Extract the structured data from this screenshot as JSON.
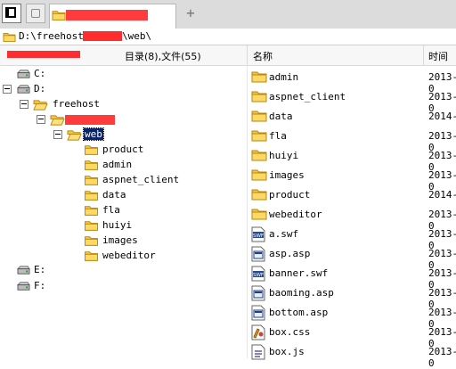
{
  "path": {
    "prefix": "D:\\freehost\\",
    "suffix": "\\web\\"
  },
  "header": {
    "counts": "目录(8),文件(55)",
    "col_name": "名称",
    "col_time": "时间"
  },
  "tree": {
    "drive_c": "C:",
    "drive_d": "D:",
    "freehost": "freehost",
    "web": "web",
    "children": [
      "product",
      "admin",
      "aspnet_client",
      "data",
      "fla",
      "huiyi",
      "images",
      "webeditor"
    ],
    "drive_e": "E:",
    "drive_f": "F:"
  },
  "files": [
    {
      "name": "admin",
      "time": "2013-0",
      "icon": "folder-icon"
    },
    {
      "name": "aspnet_client",
      "time": "2013-0",
      "icon": "folder-icon"
    },
    {
      "name": "data",
      "time": "2014-",
      "icon": "folder-icon"
    },
    {
      "name": "fla",
      "time": "2013-0",
      "icon": "folder-icon"
    },
    {
      "name": "huiyi",
      "time": "2013-0",
      "icon": "folder-icon"
    },
    {
      "name": "images",
      "time": "2013-0",
      "icon": "folder-icon"
    },
    {
      "name": "product",
      "time": "2014-",
      "icon": "folder-icon"
    },
    {
      "name": "webeditor",
      "time": "2013-0",
      "icon": "folder-icon"
    },
    {
      "name": "a.swf",
      "time": "2013-0",
      "icon": "swf-file-icon"
    },
    {
      "name": "asp.asp",
      "time": "2013-0",
      "icon": "asp-file-icon"
    },
    {
      "name": "banner.swf",
      "time": "2013-0",
      "icon": "swf-file-icon"
    },
    {
      "name": "baoming.asp",
      "time": "2013-0",
      "icon": "asp-file-icon"
    },
    {
      "name": "bottom.asp",
      "time": "2013-0",
      "icon": "asp-file-icon"
    },
    {
      "name": "box.css",
      "time": "2013-0",
      "icon": "css-file-icon"
    },
    {
      "name": "box.js",
      "time": "2013-0",
      "icon": "js-file-icon"
    }
  ],
  "colors": {
    "redaction": "#ff3b3b",
    "folder": "#f5c542",
    "selection": "#0a246a"
  }
}
